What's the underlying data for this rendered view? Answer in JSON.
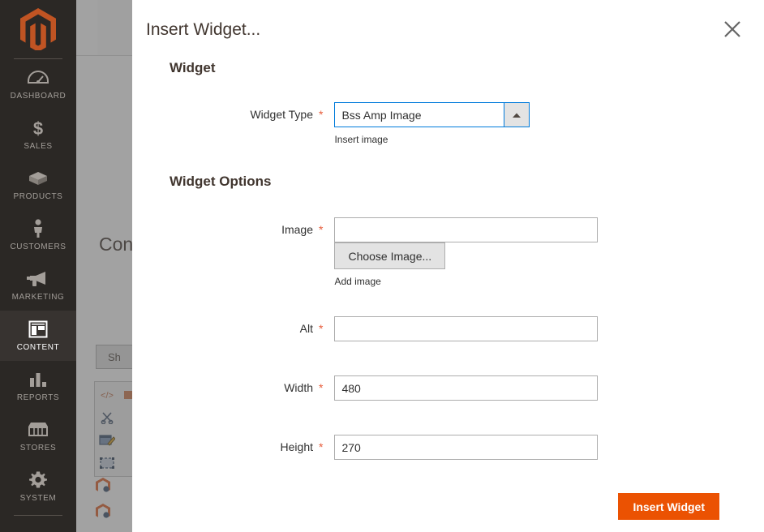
{
  "sidebar": {
    "logo": "magento-logo",
    "items": [
      {
        "label": "DASHBOARD",
        "icon": "dashboard-gauge-icon",
        "active": false
      },
      {
        "label": "SALES",
        "icon": "dollar-sign-icon",
        "active": false
      },
      {
        "label": "PRODUCTS",
        "icon": "box-icon",
        "active": false
      },
      {
        "label": "CUSTOMERS",
        "icon": "person-icon",
        "active": false
      },
      {
        "label": "MARKETING",
        "icon": "megaphone-icon",
        "active": false
      },
      {
        "label": "CONTENT",
        "icon": "layout-icon",
        "active": true
      },
      {
        "label": "REPORTS",
        "icon": "bar-chart-icon",
        "active": false
      },
      {
        "label": "STORES",
        "icon": "storefront-icon",
        "active": false
      },
      {
        "label": "SYSTEM",
        "icon": "gear-icon",
        "active": false
      }
    ]
  },
  "background_page": {
    "page_title": "Con",
    "show_button": "Sh",
    "editor_toolbar_icons": [
      "source-code-icon",
      "cut-scissors-icon",
      "edit-table-icon",
      "insert-image-icon"
    ],
    "widget_icons": [
      "magento-widget-icon",
      "magento-widget-icon"
    ]
  },
  "modal": {
    "title": "Insert Widget...",
    "close_icon": "close-icon",
    "widget_section": {
      "heading": "Widget",
      "widget_type": {
        "label": "Widget Type",
        "required_marker": "*",
        "value": "Bss Amp Image",
        "dropdown_icon": "chevron-up-icon",
        "note": "Insert image"
      }
    },
    "options_section": {
      "heading": "Widget Options",
      "fields": [
        {
          "label": "Image",
          "required_marker": "*",
          "value": "",
          "placeholder": "",
          "button": "Choose Image...",
          "note": "Add image"
        },
        {
          "label": "Alt",
          "required_marker": "*",
          "value": "",
          "placeholder": ""
        },
        {
          "label": "Width",
          "required_marker": "*",
          "value": "480",
          "placeholder": ""
        },
        {
          "label": "Height",
          "required_marker": "*",
          "value": "270",
          "placeholder": ""
        }
      ]
    },
    "footer": {
      "insert_button": "Insert Widget"
    }
  },
  "colors": {
    "accent_orange": "#eb5202",
    "magento_logo_orange": "#c05423",
    "sidebar_bg": "#2b2825",
    "sidebar_active_bg": "#373330",
    "required_star": "#e75d3b",
    "focus_blue": "#007bdb",
    "text_dark": "#303030"
  }
}
